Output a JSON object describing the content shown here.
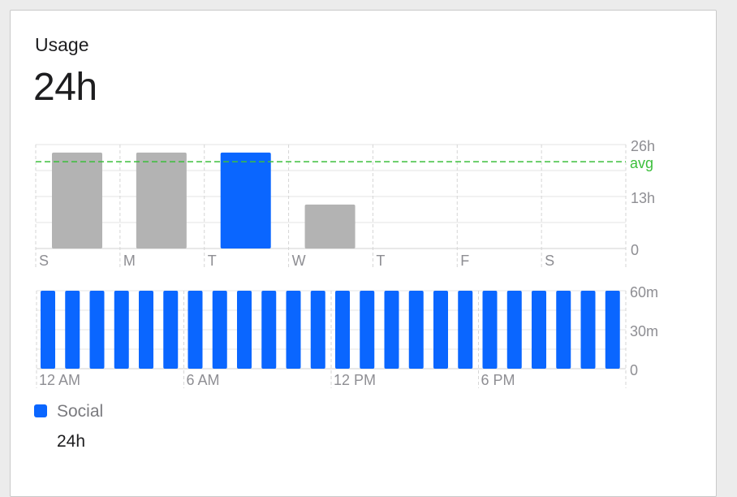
{
  "header": {
    "title": "Usage",
    "total": "24h"
  },
  "colors": {
    "accent": "#0a66ff",
    "muted_bar": "#b3b3b3",
    "avg_line": "#3cbf3c"
  },
  "chart_data": [
    {
      "type": "bar",
      "categories": [
        "S",
        "M",
        "T",
        "W",
        "T",
        "F",
        "S"
      ],
      "values": [
        24,
        24,
        24,
        11,
        0,
        0,
        0
      ],
      "highlight_index": 2,
      "y_ticks": [
        "26h",
        "13h",
        "0"
      ],
      "ylim": [
        0,
        26
      ],
      "average": 21.7,
      "average_label": "avg",
      "grid": true
    },
    {
      "type": "bar",
      "values": [
        60,
        60,
        60,
        60,
        60,
        60,
        60,
        60,
        60,
        60,
        60,
        60,
        60,
        60,
        60,
        60,
        60,
        60,
        60,
        60,
        60,
        60,
        60,
        60
      ],
      "x_ticks": [
        "12 AM",
        "6 AM",
        "12 PM",
        "6 PM"
      ],
      "y_ticks": [
        "60m",
        "30m",
        "0"
      ],
      "ylim": [
        0,
        60
      ],
      "grid": true
    }
  ],
  "legend": [
    {
      "name": "Social",
      "value": "24h",
      "color": "#0a66ff"
    }
  ]
}
